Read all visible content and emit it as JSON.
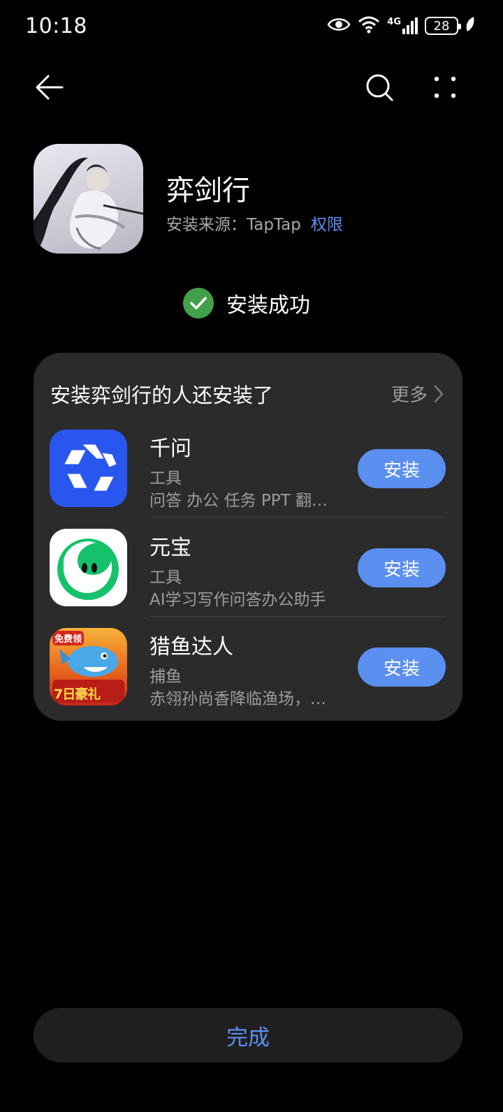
{
  "status_bar": {
    "time": "10:18",
    "network_label": "4G",
    "battery": "28"
  },
  "nav": {
    "back_icon": "arrow-left-icon",
    "search_icon": "search-icon",
    "more_icon": "more-dots-icon"
  },
  "app": {
    "name": "弈剑行",
    "source_label": "安装来源：TapTap",
    "permissions_link": "权限"
  },
  "install_status": {
    "text": "安装成功",
    "color": "#43a04a"
  },
  "recommendations": {
    "title": "安装弈剑行的人还安装了",
    "more_label": "更多",
    "items": [
      {
        "name": "千问",
        "category": "工具",
        "description": "问答 办公 任务 PPT 翻…",
        "button": "安装"
      },
      {
        "name": "元宝",
        "category": "工具",
        "description": "AI学习写作问答办公助手",
        "button": "安装"
      },
      {
        "name": "猎鱼达人",
        "category": "捕鱼",
        "description": "赤翎孙尚香降临渔场，…",
        "button": "安装",
        "icon_badge_top": "免费领",
        "icon_badge_bottom": "7日豪礼"
      }
    ]
  },
  "done_button": "完成",
  "colors": {
    "accent": "#5b8ff0",
    "card_bg": "#2b2b2b",
    "background": "#000000"
  }
}
